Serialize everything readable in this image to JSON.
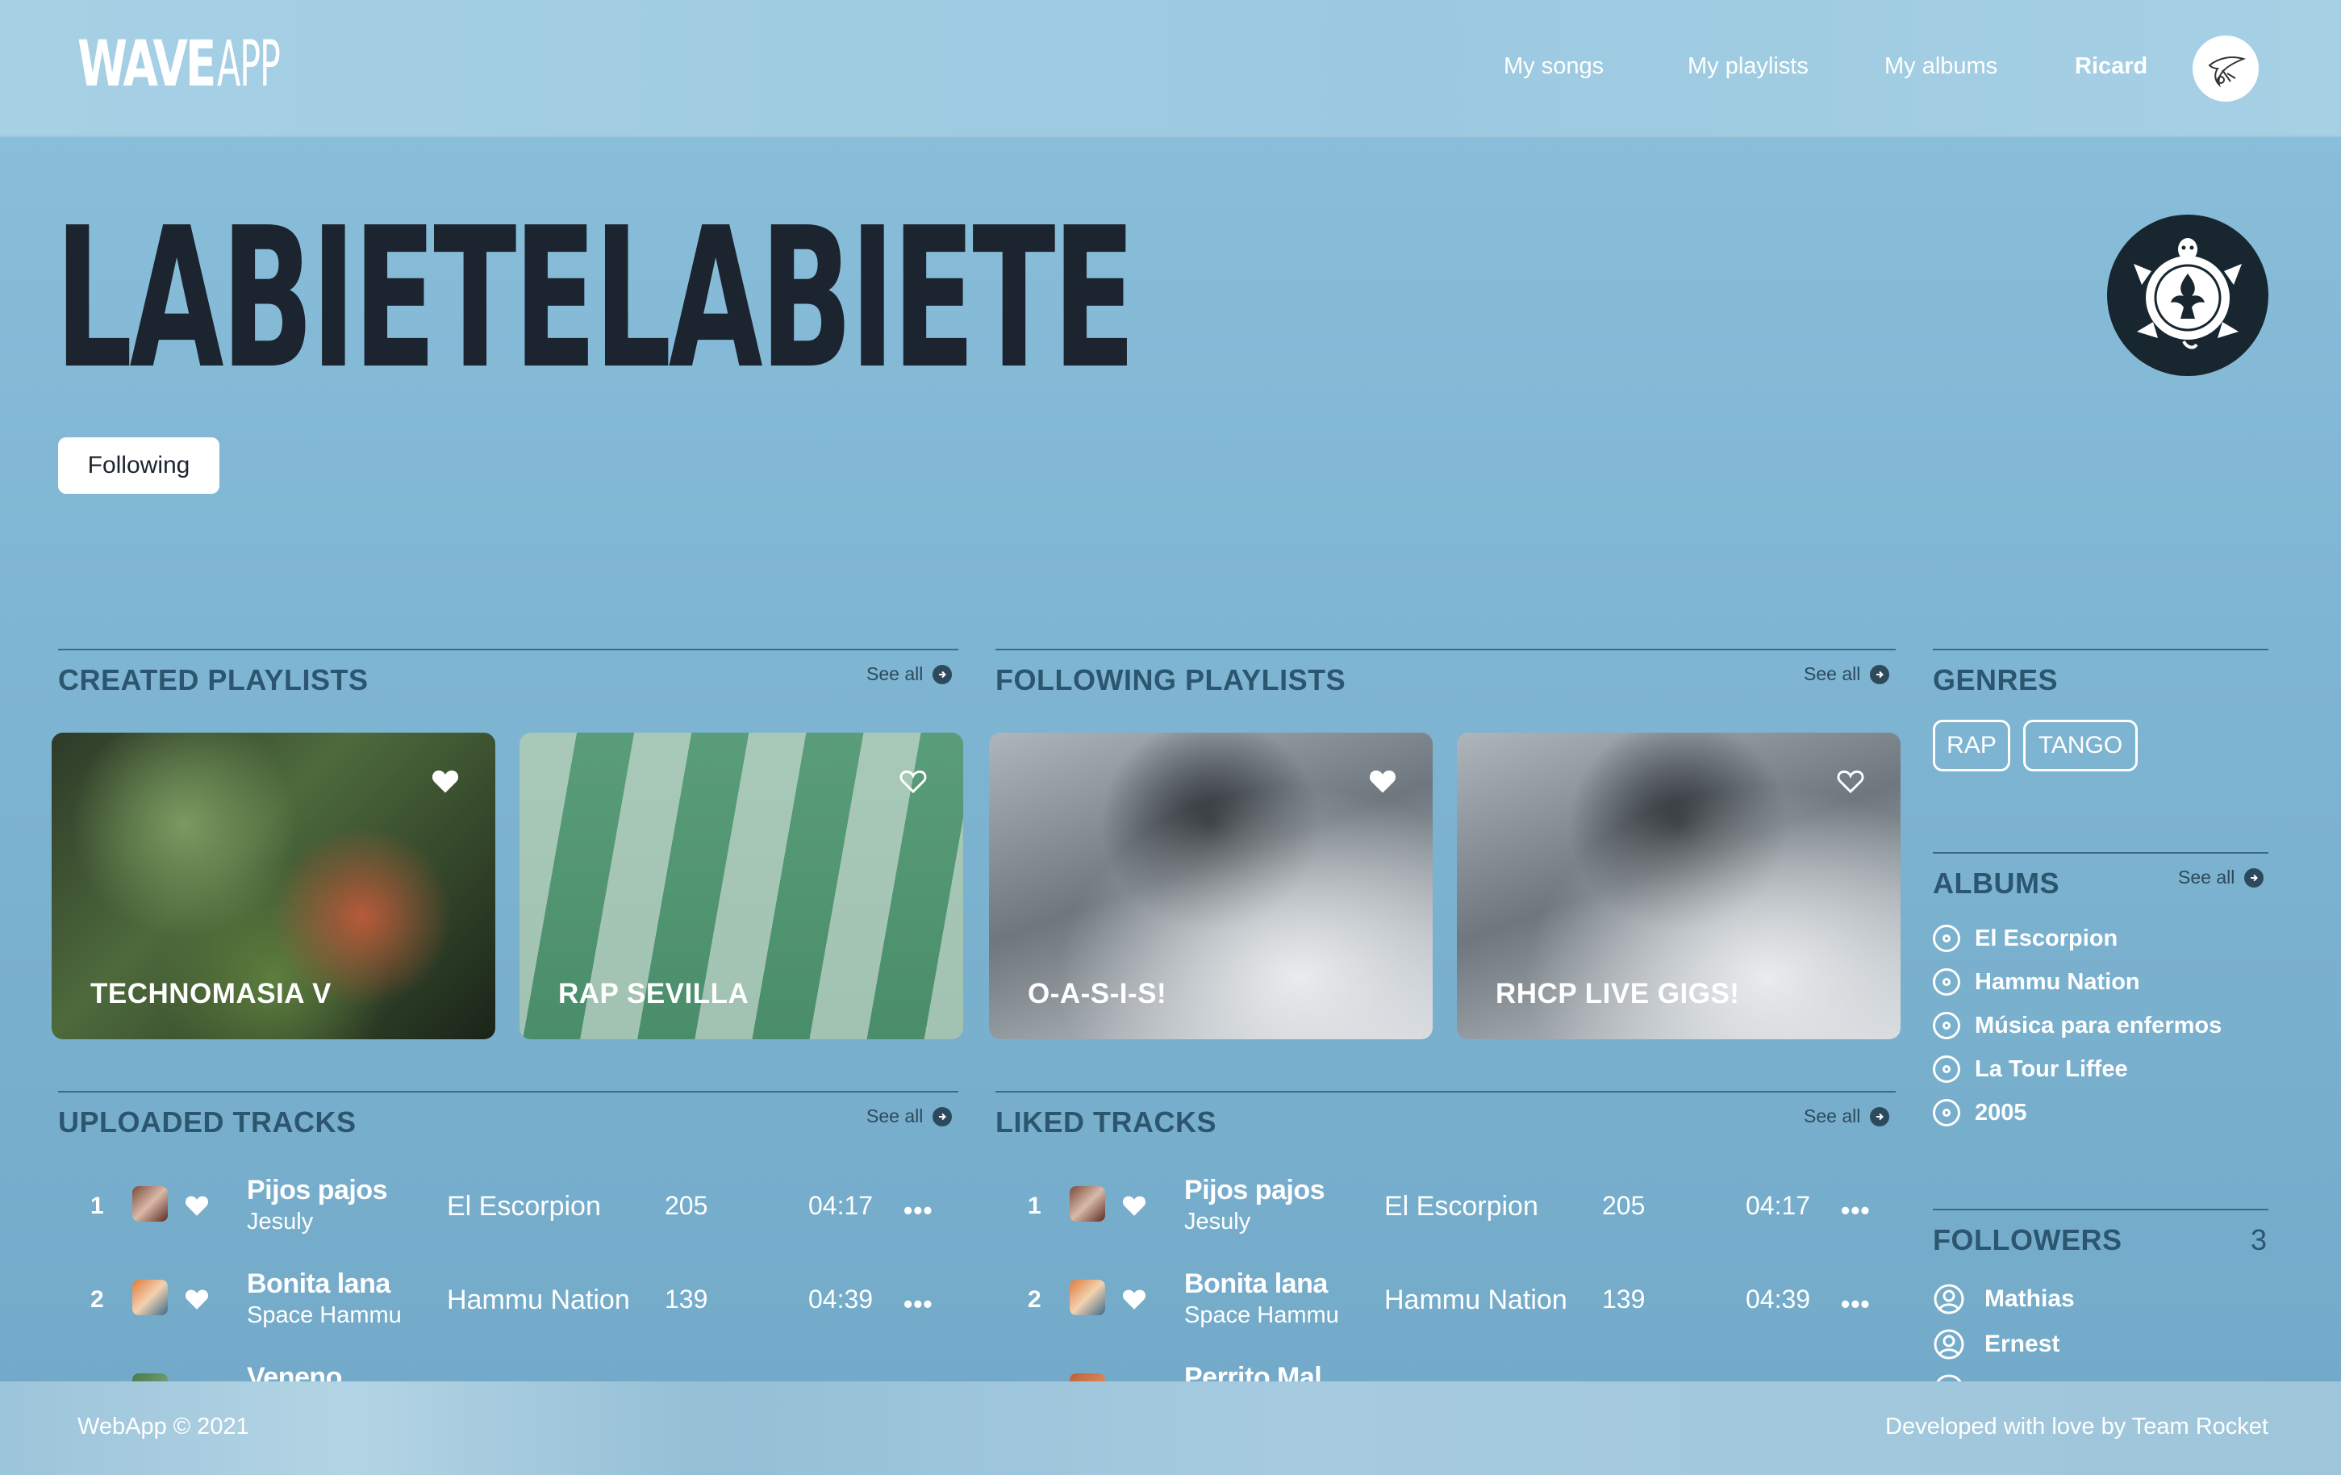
{
  "app": {
    "logo_wave": "WAVE",
    "logo_app": "APP"
  },
  "nav": {
    "my_songs": "My songs",
    "my_playlists": "My playlists",
    "my_albums": "My albums",
    "user_name": "Ricard",
    "avatar_icon": "bird-avatar-icon"
  },
  "artist": {
    "name": "LABIETELABIETE",
    "follow_label": "Following",
    "badge_icon": "turtle-logo-icon"
  },
  "sections": {
    "created_playlists": "CREATED PLAYLISTS",
    "following_playlists": "FOLLOWING PLAYLISTS",
    "uploaded_tracks": "UPLOADED TRACKS",
    "liked_tracks": "LIKED TRACKS",
    "genres": "GENRES",
    "albums": "ALBUMS",
    "followers": "FOLLOWERS",
    "see_all": "See all"
  },
  "created_playlists": [
    {
      "title": "TECHNOMASIA V",
      "liked": true
    },
    {
      "title": "RAP SEVILLA",
      "liked": false
    }
  ],
  "following_playlists": [
    {
      "title": "O-A-S-I-S!",
      "liked": true
    },
    {
      "title": "RHCP LIVE GIGS!",
      "liked": false
    }
  ],
  "uploaded_tracks": [
    {
      "num": "1",
      "song": "Pijos pajos",
      "artist": "Jesuly",
      "album": "El Escorpion",
      "plays": "205",
      "duration": "04:17",
      "more": "•••"
    },
    {
      "num": "2",
      "song": "Bonita lana",
      "artist": "Space Hammu",
      "album": "Hammu Nation",
      "plays": "139",
      "duration": "04:39",
      "more": "•••"
    },
    {
      "num": "3",
      "song": "Veneno"
    }
  ],
  "liked_tracks": [
    {
      "num": "1",
      "song": "Pijos pajos",
      "artist": "Jesuly",
      "album": "El Escorpion",
      "plays": "205",
      "duration": "04:17",
      "more": "•••"
    },
    {
      "num": "2",
      "song": "Bonita lana",
      "artist": "Space Hammu",
      "album": "Hammu Nation",
      "plays": "139",
      "duration": "04:39",
      "more": "•••"
    },
    {
      "num": "3",
      "song": "Perrito Mal"
    }
  ],
  "genres": [
    "RAP",
    "TANGO"
  ],
  "albums": [
    "El Escorpion",
    "Hammu Nation",
    "Música para enfermos",
    "La Tour Liffee",
    "2005"
  ],
  "followers": {
    "count": "3",
    "names": [
      "Mathias",
      "Ernest"
    ]
  },
  "footer": {
    "left": "WebApp © 2021",
    "right": "Developed with love by Team Rocket"
  },
  "colors": {
    "background": "#7fb6d3",
    "header": "#9cc9e1",
    "title_dark": "#1c2430",
    "section_title": "#2c5670",
    "badge_bg": "#18262f"
  }
}
